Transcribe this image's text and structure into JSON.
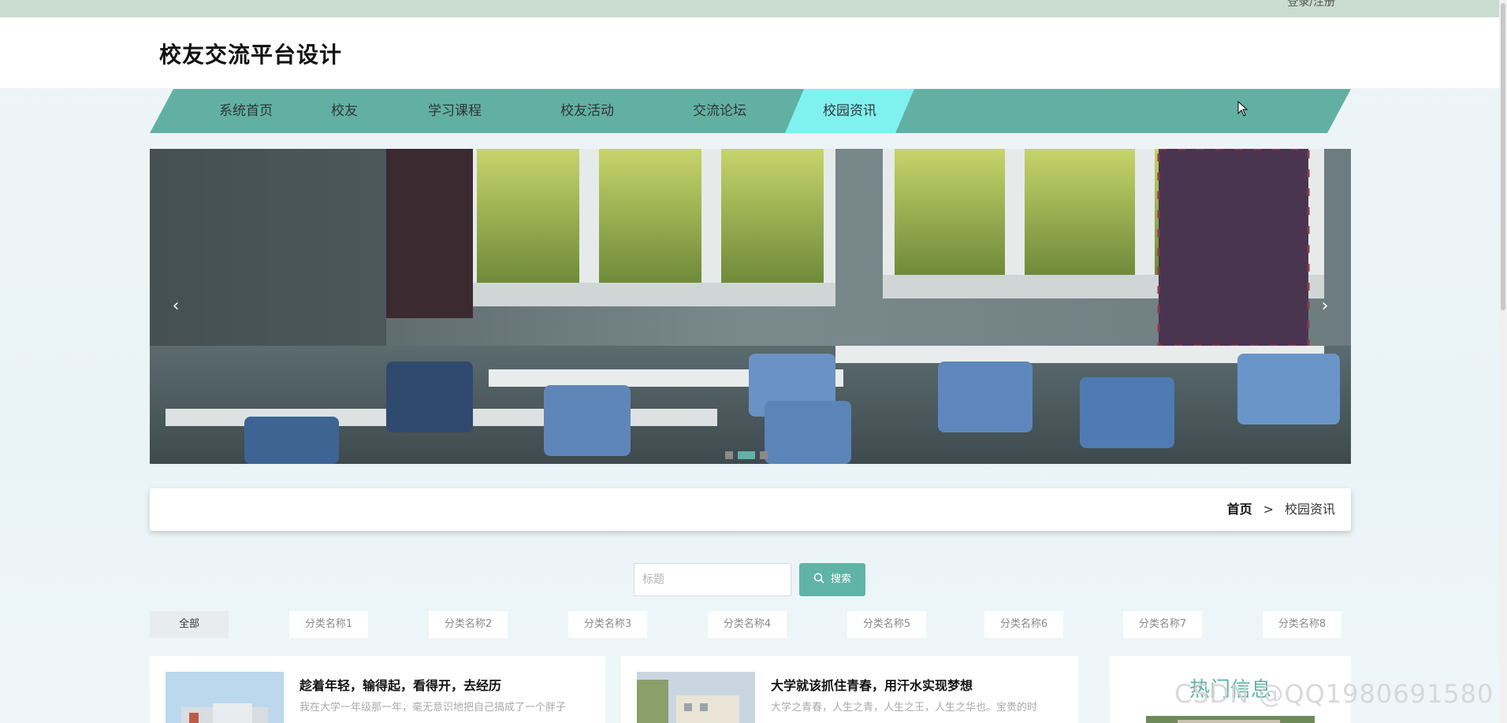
{
  "topbar": {
    "login_text": "登录/注册"
  },
  "header": {
    "site_title": "校友交流平台设计"
  },
  "nav": {
    "items": [
      {
        "label": "系统首页"
      },
      {
        "label": "校友"
      },
      {
        "label": "学习课程"
      },
      {
        "label": "校友活动"
      },
      {
        "label": "交流论坛"
      },
      {
        "label": "校园资讯"
      }
    ],
    "active": "校园资讯"
  },
  "banner": {
    "prev_icon": "‹",
    "next_icon": "›",
    "dots": 3,
    "active_dot": 2
  },
  "breadcrumb": {
    "home": "首页",
    "separator": ">",
    "current": "校园资讯"
  },
  "search": {
    "placeholder": "标题",
    "button_label": "搜索",
    "icon": "search-icon"
  },
  "categories": {
    "items": [
      {
        "label": "全部"
      },
      {
        "label": "分类名称1"
      },
      {
        "label": "分类名称2"
      },
      {
        "label": "分类名称3"
      },
      {
        "label": "分类名称4"
      },
      {
        "label": "分类名称5"
      },
      {
        "label": "分类名称6"
      },
      {
        "label": "分类名称7"
      },
      {
        "label": "分类名称8"
      }
    ],
    "active": "全部"
  },
  "news": [
    {
      "title": "趁着年轻，输得起，看得开，去经历",
      "desc": "我在大学一年级那一年，毫无意识地把自己搞成了一个胖子"
    },
    {
      "title": "大学就该抓住青春，用汗水实现梦想",
      "desc": "大学之青春，人生之青，人生之王，人生之华也。宝贵的时"
    }
  ],
  "hot": {
    "title": "热门信息"
  },
  "watermark": "CSDN @QQ1980691580",
  "colors": {
    "accent": "#5fb3a7",
    "nav_bg": "#62b0a4",
    "nav_active": "#7ff2f0",
    "topbar": "#c9dccf"
  }
}
